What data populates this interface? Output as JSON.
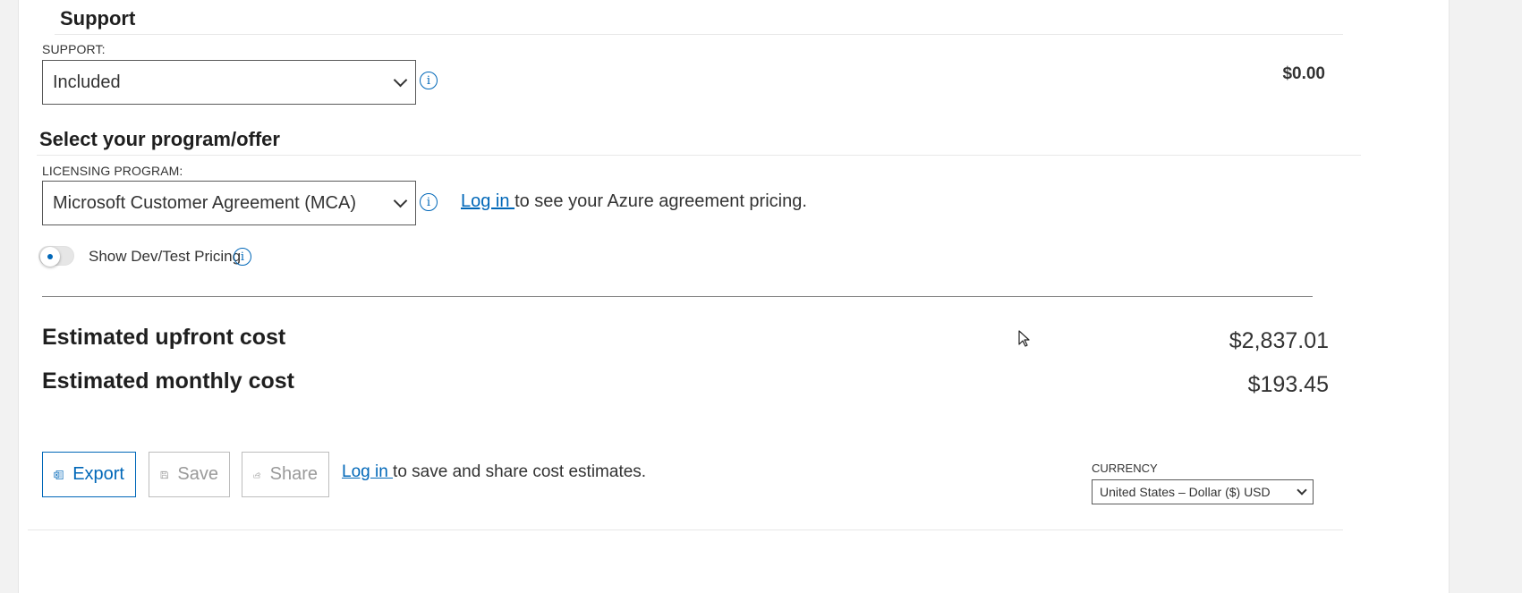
{
  "support": {
    "title": "Support",
    "field_label": "SUPPORT:",
    "selected": "Included",
    "price": "$0.00"
  },
  "program": {
    "title": "Select your program/offer",
    "field_label": "LICENSING PROGRAM:",
    "selected": "Microsoft Customer Agreement (MCA)",
    "login_link": "Log in ",
    "login_suffix": "to see your Azure agreement pricing."
  },
  "devtest": {
    "label": "Show Dev/Test Pricing",
    "enabled": false
  },
  "costs": {
    "upfront_label": "Estimated upfront cost",
    "upfront_value": "$2,837.01",
    "monthly_label": "Estimated monthly cost",
    "monthly_value": "$193.45"
  },
  "actions": {
    "export_label": "Export",
    "save_label": "Save",
    "share_label": "Share",
    "login_link": "Log in ",
    "login_suffix": "to save and share cost estimates."
  },
  "currency": {
    "label": "CURRENCY",
    "selected": "United States – Dollar ($) USD"
  },
  "icons": {
    "info": "info-icon",
    "excel": "excel-icon",
    "save": "save-icon",
    "share": "share-icon",
    "chevron": "chevron-down-icon"
  },
  "colors": {
    "accent": "#0067b8",
    "disabled": "#9a9a9a"
  }
}
